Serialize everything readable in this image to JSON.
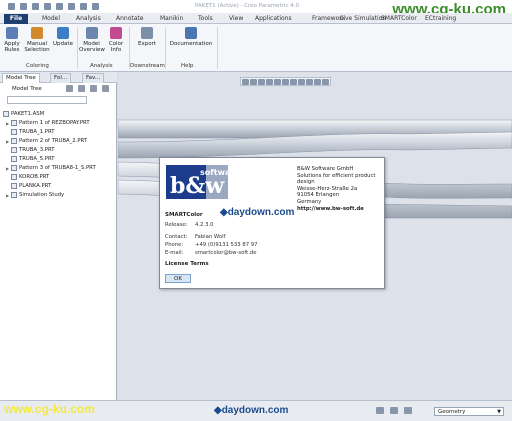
{
  "window": {
    "title": "PAKET1 (Active) - Creo Parametric 4.0",
    "watermark_top": "www.cg-ku.com"
  },
  "tabs": [
    "File",
    "Model",
    "Analysis",
    "Annotate",
    "Manikin",
    "Tools",
    "View",
    "Applications",
    "Framework",
    "Live Simulation",
    "SMARTColor",
    "ECtraining"
  ],
  "ribbon": {
    "buttons": [
      {
        "label": "Apply Rules",
        "icon": "apply-rules-icon",
        "color": "#5b7fb5"
      },
      {
        "label": "Manual Selection",
        "icon": "manual-selection-icon",
        "color": "#d38a2f"
      },
      {
        "label": "Update",
        "icon": "update-icon",
        "color": "#3b7ec6"
      },
      {
        "label": "Model Overview",
        "icon": "model-overview-icon",
        "color": "#6b87b0"
      },
      {
        "label": "Color Info",
        "icon": "color-info-icon",
        "color": "#c24a8e"
      },
      {
        "label": "Export",
        "icon": "export-icon",
        "color": "#7b8fa8"
      },
      {
        "label": "Documentation",
        "icon": "documentation-icon",
        "color": "#4a76b2"
      }
    ],
    "groups": [
      "Coloring",
      "Analysis",
      "Downstream",
      "Help"
    ]
  },
  "left_panel": {
    "tabs": [
      "Model Tree",
      "Fol...",
      "Fav..."
    ],
    "header": "Model Tree",
    "tree": [
      {
        "label": "PAKET1.ASM",
        "expandable": false
      },
      {
        "label": "Pattern 1 of REZBOPAY.PRT",
        "expandable": true
      },
      {
        "label": "TRUBA_1.PRT",
        "expandable": false
      },
      {
        "label": "Pattern 2 of TRUBA_2.PRT",
        "expandable": true
      },
      {
        "label": "TRUBA_3.PRT",
        "expandable": false
      },
      {
        "label": "TRUBA_5.PRT",
        "expandable": false
      },
      {
        "label": "Pattern 3 of TRUBA8-1_S.PRT",
        "expandable": true
      },
      {
        "label": "KOROB.PRT",
        "expandable": false
      },
      {
        "label": "PLANKA.PRT",
        "expandable": false
      },
      {
        "label": "Simulation Study",
        "expandable": true
      }
    ]
  },
  "dialog": {
    "company": [
      "B&W Software GmbH",
      "Solutions for efficient product design",
      "Weisse-Herz-Straße 2a",
      "91054 Erlangen",
      "Germany"
    ],
    "url": "http://www.bw-soft.de",
    "product": "SMARTColor",
    "watermark": "daydown.com",
    "fields": [
      {
        "key": "Release:",
        "value": "4.2.3.0"
      },
      {
        "key": "Contact:",
        "value": "Fabian Wolf"
      },
      {
        "key": "Phone:",
        "value": "+49 (0)9131 533 87 97"
      },
      {
        "key": "E-mail:",
        "value": "smartcolor@bw-soft.de"
      }
    ],
    "license": "License Terms",
    "ok": "OK"
  },
  "status": {
    "watermark_left": "www.cg-ku.com",
    "watermark_center": "daydown.com",
    "filter_value": "Geometry"
  }
}
